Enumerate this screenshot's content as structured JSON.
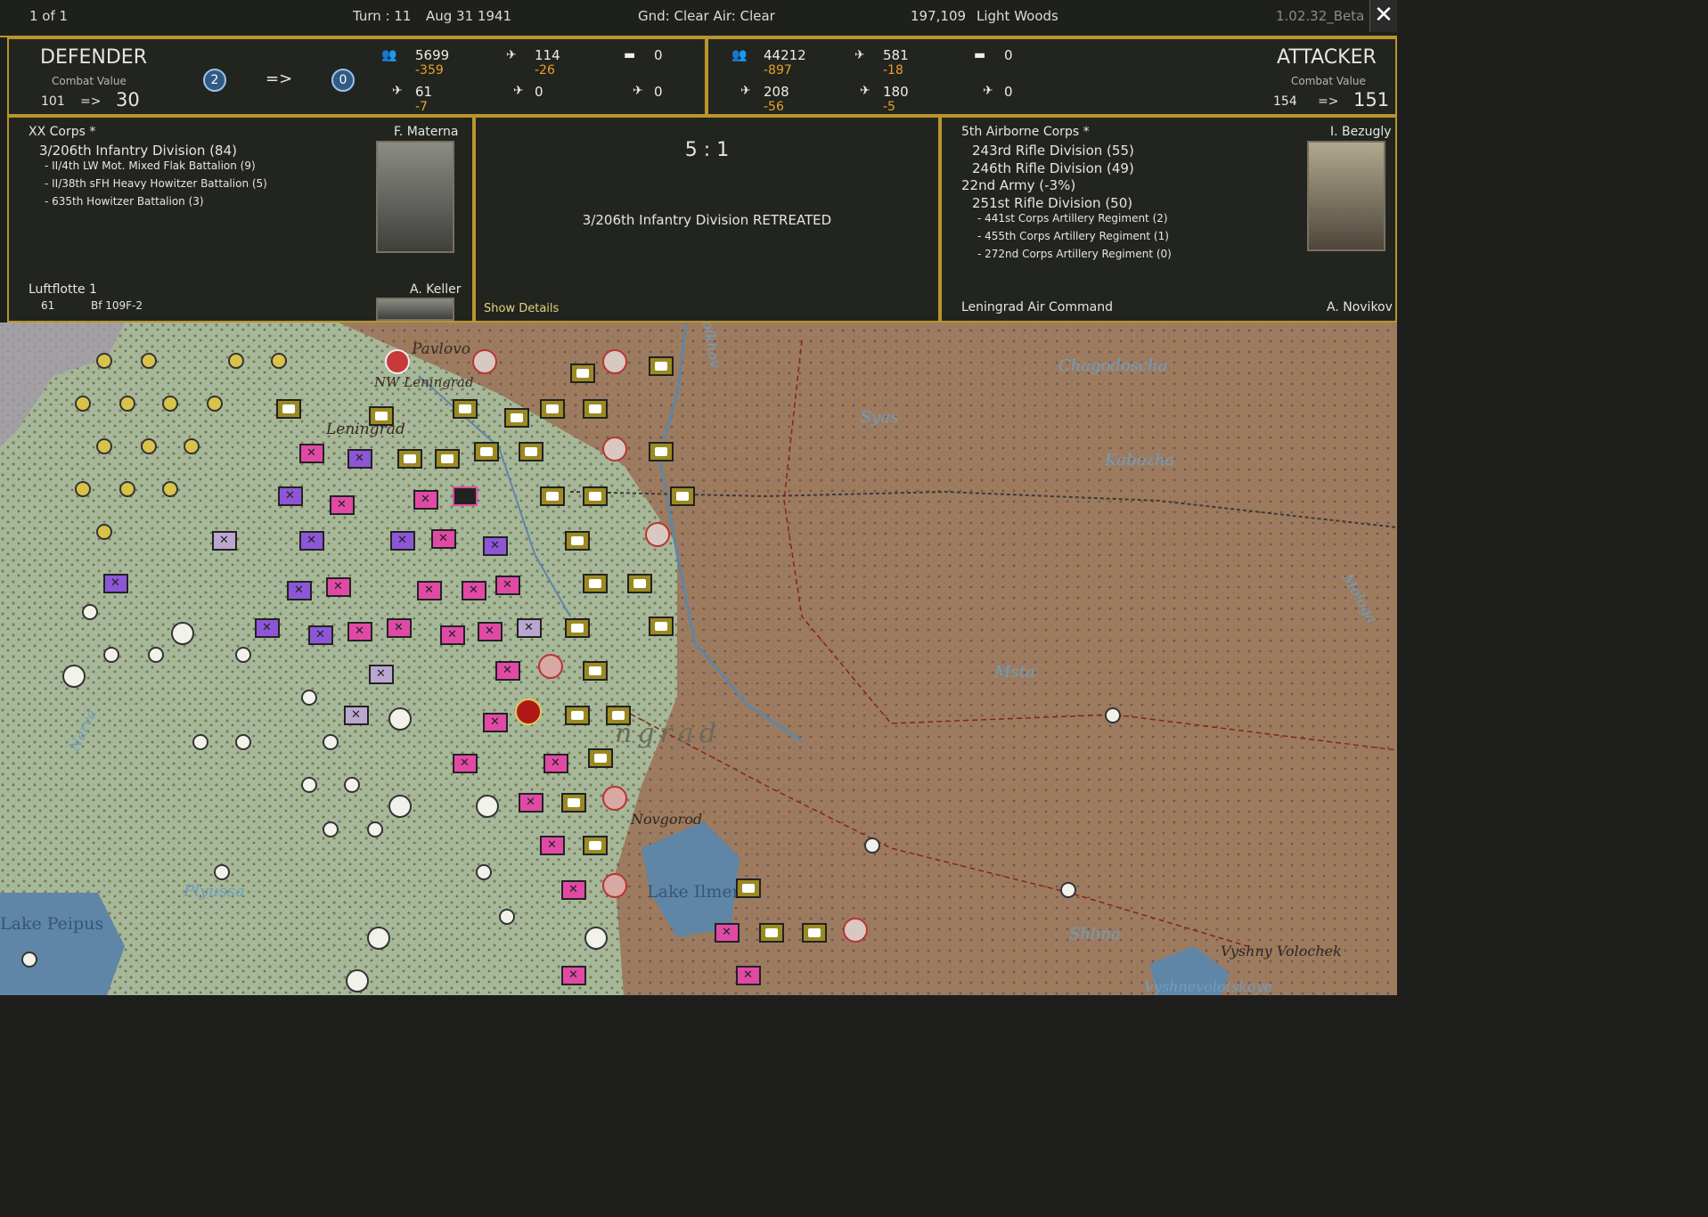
{
  "topbar": {
    "page_counter": "1 of 1",
    "turn": "Turn : 11",
    "date": "Aug 31 1941",
    "ground_air": "Gnd: Clear  Air: Clear",
    "hex_id": "197,109",
    "terrain": "Light Woods",
    "version": "1.02.32_Beta",
    "close_label": "✕"
  },
  "defender": {
    "title": "DEFENDER",
    "cv_label": "Combat Value",
    "cv_before": "101",
    "arrow": "=>",
    "cv_after": "30",
    "fort_before": "2",
    "fort_arrow": "=>",
    "fort_after": "0",
    "men": "5699",
    "men_loss": "-359",
    "aircraft": "114",
    "aircraft_loss": "-26",
    "tanks": "0",
    "fighters": "61",
    "fighters_loss": "-7",
    "bombers": "0",
    "transports": "0"
  },
  "attacker": {
    "title": "ATTACKER",
    "cv_label": "Combat Value",
    "cv_before": "154",
    "arrow": "=>",
    "cv_after": "151",
    "men": "44212",
    "men_loss": "-897",
    "aircraft": "581",
    "aircraft_loss": "-18",
    "tanks": "0",
    "fighters": "208",
    "fighters_loss": "-56",
    "bombers": "180",
    "bombers_loss": "-5",
    "transports": "0"
  },
  "def_detail": {
    "corps": "XX Corps *",
    "commander": "F. Materna",
    "division": "3/206th Infantry Division (84)",
    "attachments": [
      "- II/4th LW Mot. Mixed Flak Battalion (9)",
      "- II/38th sFH Heavy Howitzer Battalion (5)",
      "- 635th Howitzer Battalion (3)"
    ],
    "air_hq": "Luftflotte 1",
    "air_commander": "A. Keller",
    "air_count": "61",
    "air_type": "Bf 109F-2"
  },
  "result": {
    "ratio": "5 : 1",
    "message": "3/206th Infantry Division RETREATED",
    "show_details": "Show Details"
  },
  "att_detail": {
    "corps": "5th Airborne Corps *",
    "commander": "I. Bezugly",
    "units": [
      "243rd Rifle Division (55)",
      "246th Rifle Division (49)"
    ],
    "army": "22nd Army (-3%)",
    "army_unit": "251st Rifle Division (50)",
    "attachments": [
      "- 441st Corps Artillery Regiment (2)",
      "- 455th Corps Artillery Regiment (1)",
      "- 272nd Corps Artillery Regiment (0)"
    ],
    "air_hq": "Leningrad Air Command",
    "air_commander": "A. Novikov"
  },
  "map": {
    "labels": [
      "Pavlovo",
      "NW Leningrad",
      "Leningrad",
      "Chagodoscha",
      "Syas",
      "Kabozha",
      "Mologa",
      "Msta",
      "Novgorod",
      "Lake Ilmen",
      "Lake Peipus",
      "Plyussa",
      "Shlina",
      "Vyshny Volochek",
      "Vyshnevolotskoye",
      "Narva",
      "Volkhov",
      "ngrad"
    ],
    "colors": {
      "axis_terrain": "#a7b79a",
      "soviet_terrain": "#9c7b62",
      "forest": "#6e5a2a",
      "lake": "#5f86a6"
    }
  }
}
